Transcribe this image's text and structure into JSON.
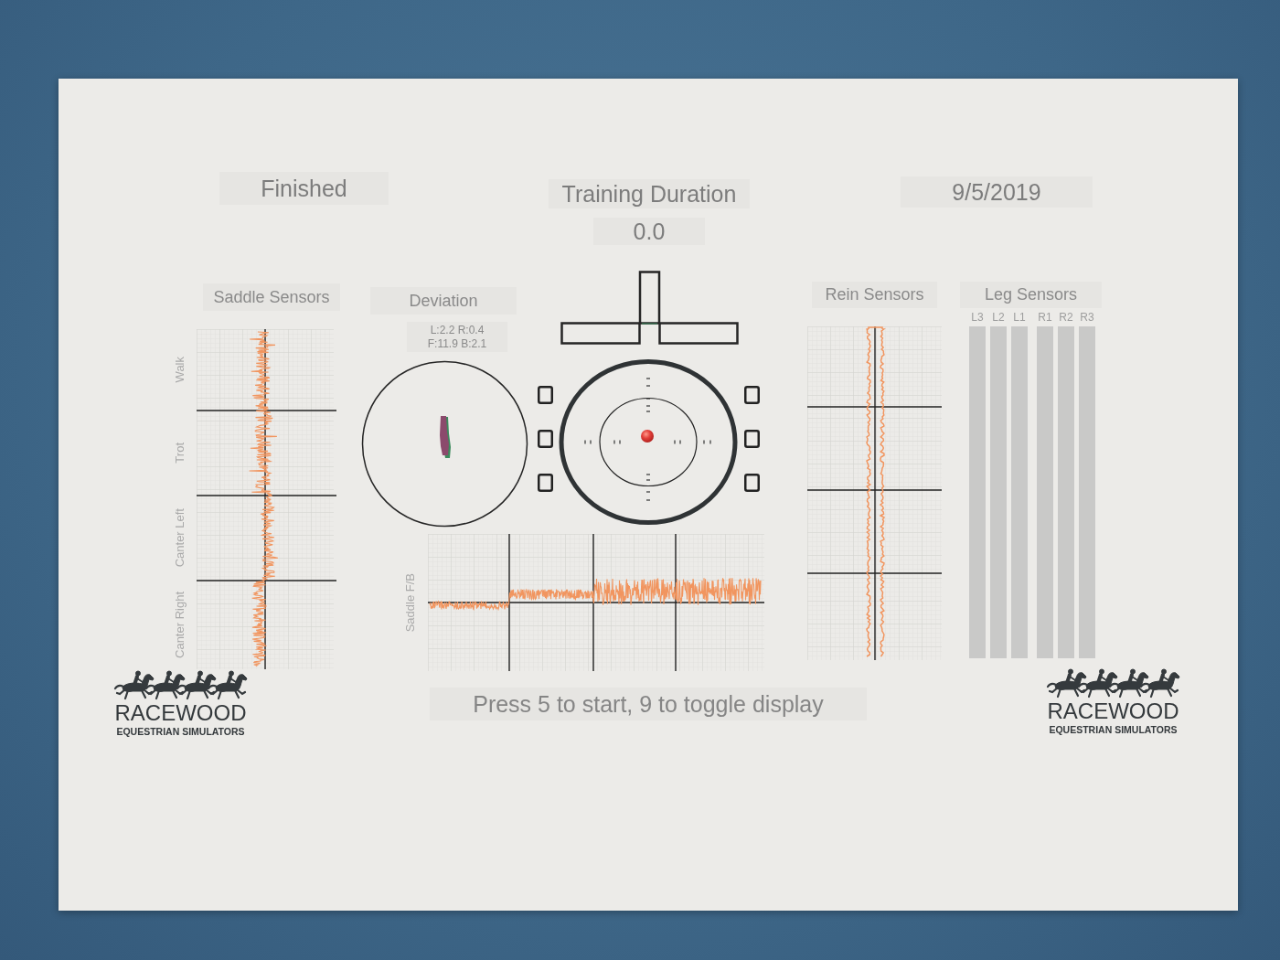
{
  "status": "Finished",
  "training_duration": {
    "label": "Training Duration",
    "value": "0.0"
  },
  "date": "9/5/2019",
  "saddle_sensors": {
    "title": "Saddle Sensors",
    "gaits": [
      "Walk",
      "Trot",
      "Canter Left",
      "Canter Right"
    ]
  },
  "deviation": {
    "title": "Deviation",
    "readings": [
      "L:2.2 R:0.4",
      "F:11.9 B:2.1"
    ]
  },
  "saddle_fb": {
    "label": "Saddle F/B"
  },
  "rein_sensors": {
    "title": "Rein Sensors"
  },
  "leg_sensors": {
    "title": "Leg Sensors",
    "left": [
      "L3",
      "L2",
      "L1"
    ],
    "right": [
      "R1",
      "R2",
      "R3"
    ]
  },
  "prompt": "Press 5 to start, 9 to toggle display",
  "logos": [
    {
      "name": "RACEWOOD",
      "tagline": "EQUESTRIAN SIMULATORS"
    },
    {
      "name": "RACEWOOD",
      "tagline": "EQUESTRIAN SIMULATORS"
    }
  ]
}
